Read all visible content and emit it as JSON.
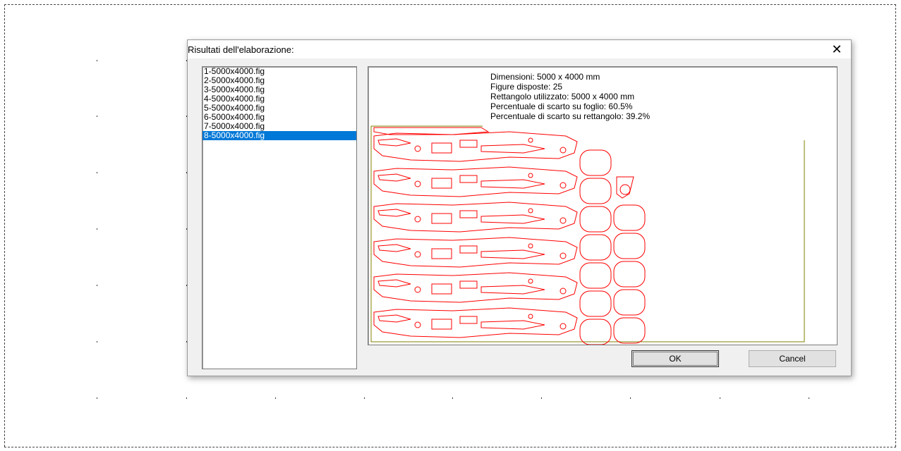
{
  "dialog": {
    "title": "Risultati dell'elaborazione:",
    "close_symbol": "✕"
  },
  "file_list": {
    "items": [
      "1-5000x4000.fig",
      "2-5000x4000.fig",
      "3-5000x4000.fig",
      "4-5000x4000.fig",
      "5-5000x4000.fig",
      "6-5000x4000.fig",
      "7-5000x4000.fig",
      "8-5000x4000.fig"
    ],
    "selected_index": 7
  },
  "info": {
    "dimensions": "Dimensioni: 5000 x 4000 mm",
    "figures": "Figure disposte: 25",
    "rectangle": "Rettangolo utilizzato: 5000 x 4000 mm",
    "waste_sheet": "Percentuale di scarto su foglio: 60.5%",
    "waste_rect": "Percentuale di scarto su rettangolo: 39.2%"
  },
  "buttons": {
    "ok": "OK",
    "cancel": "Cancel"
  },
  "colors": {
    "selection": "#0078d7",
    "shape_outline": "#ff0000",
    "sheet_border": "#808000"
  }
}
